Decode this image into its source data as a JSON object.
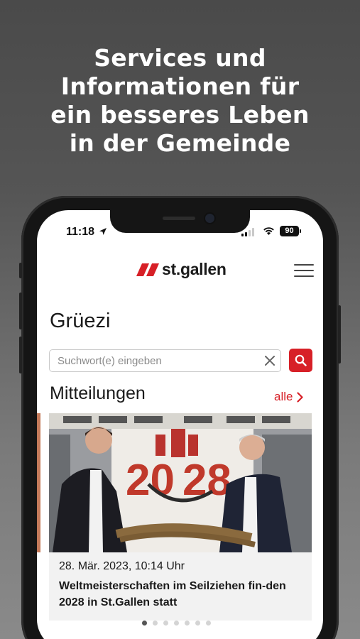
{
  "promo": {
    "headline_lines": [
      "Services und",
      "Informationen für",
      "ein besseres Leben",
      "in der Gemeinde"
    ]
  },
  "status_bar": {
    "time": "11:18",
    "battery": "90"
  },
  "header": {
    "logo_text": "st.gallen",
    "menu_icon": "hamburger-icon"
  },
  "main": {
    "greeting": "Grüezi",
    "search": {
      "placeholder": "Suchwort(e) eingeben"
    },
    "news": {
      "title": "Mitteilungen",
      "all_label": "alle",
      "items": [
        {
          "date": "28. Mär. 2023, 10:14 Uhr",
          "title": "Weltmeisterschaften im Seilziehen fin-den 2028 in St.Gallen statt"
        }
      ]
    },
    "carousel": {
      "count": 7,
      "active": 0
    }
  },
  "colors": {
    "accent": "#d72027",
    "background_top": "#4a4a4a",
    "text": "#1a1a1a"
  }
}
